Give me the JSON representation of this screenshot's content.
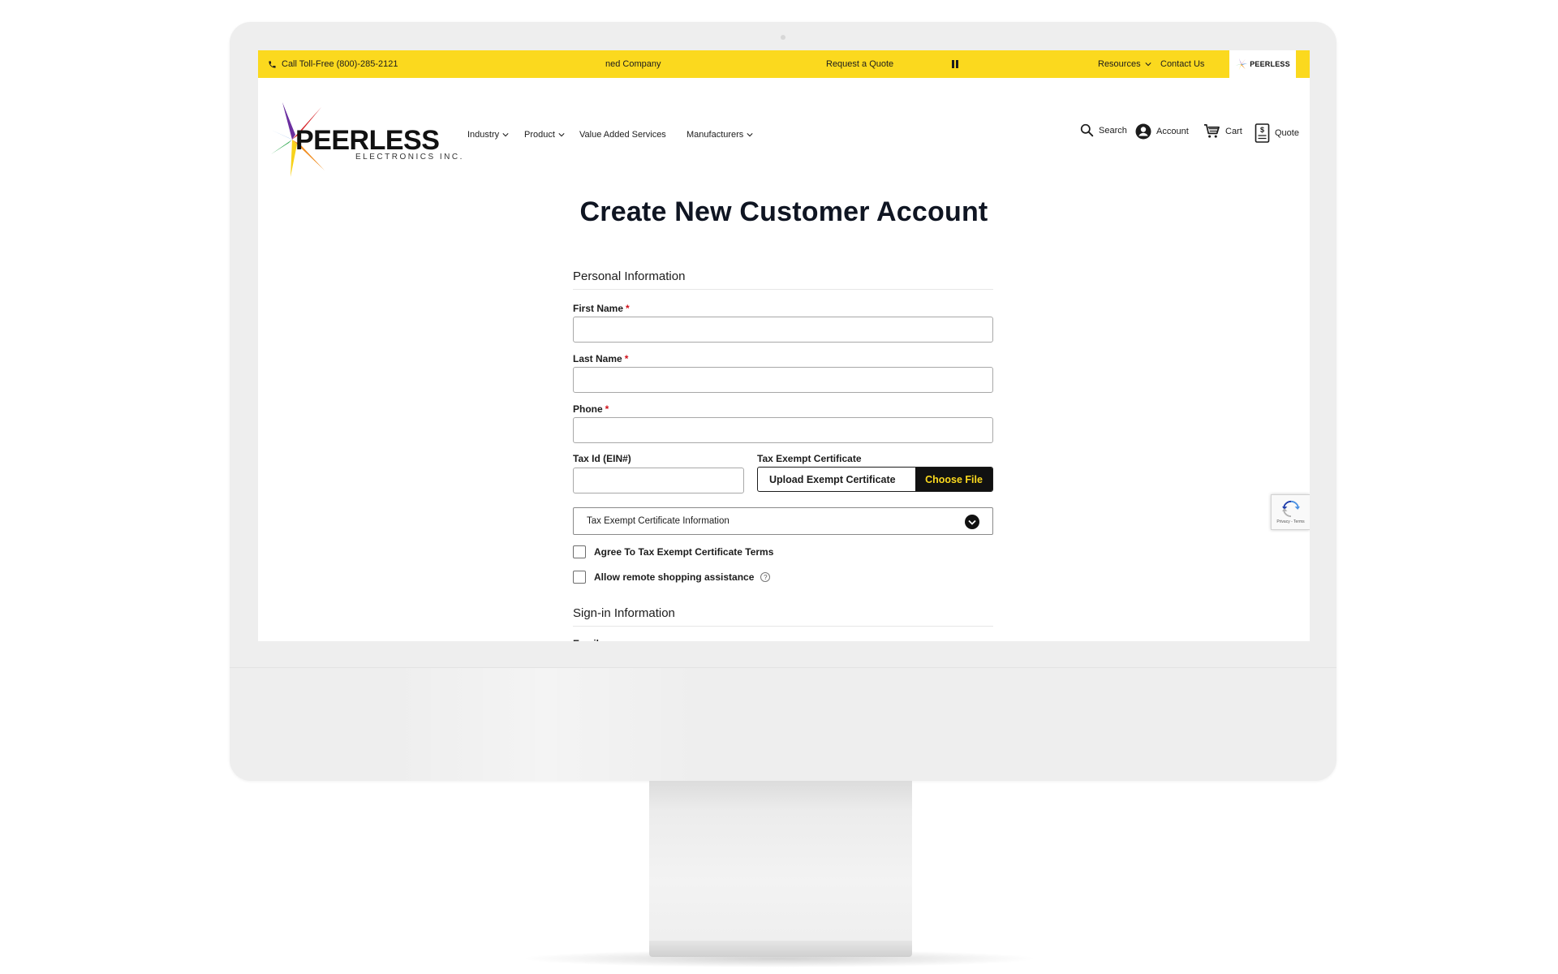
{
  "topbar": {
    "phone": "Call Toll-Free (800)-285-2121",
    "company_ticker": "ned Company",
    "request_quote": "Request a Quote",
    "resources": "Resources",
    "contact": "Contact Us",
    "brand_badge": "PEERLESS",
    "background_color": "#fbd91e"
  },
  "header": {
    "logo_name": "PEERLESS",
    "logo_subtitle": "ELECTRONICS INC.",
    "nav": {
      "industry": "Industry",
      "product": "Product",
      "value_added": "Value Added Services",
      "manufacturers": "Manufacturers"
    },
    "utility": {
      "search": "Search",
      "account": "Account",
      "cart": "Cart",
      "quote": "Quote"
    }
  },
  "form": {
    "title": "Create New Customer Account",
    "personal_section": "Personal Information",
    "first_name_label": "First Name",
    "first_name_value": "",
    "last_name_label": "Last Name",
    "last_name_value": "",
    "phone_label": "Phone",
    "phone_value": "",
    "required_mark": "*",
    "tax_id_label": "Tax Id (EIN#)",
    "tax_id_value": "",
    "tax_cert_label": "Tax Exempt Certificate",
    "upload_placeholder": "Upload Exempt Certificate",
    "choose_file": "Choose File",
    "cert_info_accordion": "Tax Exempt Certificate Information",
    "agree_terms": "Agree To Tax Exempt Certificate Terms",
    "agree_checked": false,
    "remote_assist": "Allow remote shopping assistance",
    "remote_checked": false,
    "help_glyph": "?",
    "signin_section": "Sign-in Information",
    "email_label_cut": "Email"
  },
  "recaptcha": {
    "links": "Privacy - Terms"
  },
  "icons": [
    "phone-icon",
    "pause-icon",
    "chevron-down-icon",
    "search-icon",
    "account-icon",
    "cart-icon",
    "quote-icon",
    "circle-chevron-icon",
    "help-icon",
    "recaptcha-icon"
  ]
}
